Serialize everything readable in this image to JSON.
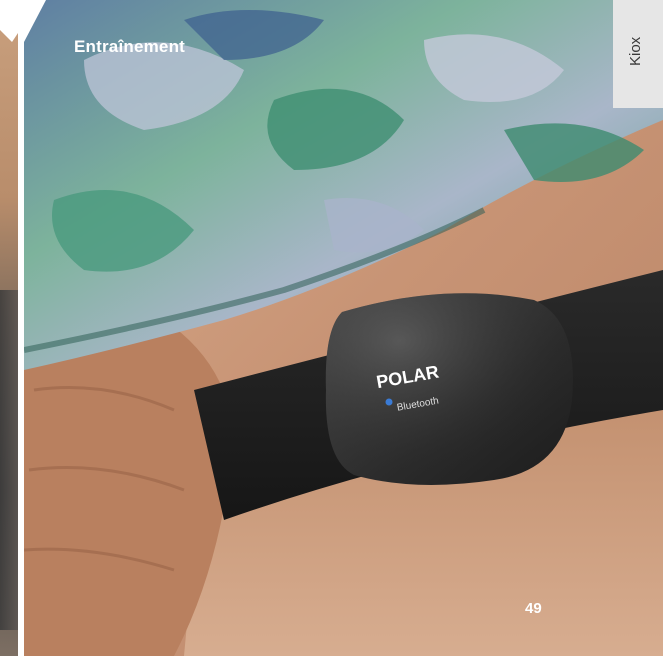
{
  "section": {
    "title": "Entraînement"
  },
  "side_tab": {
    "label": "Kiox"
  },
  "page": {
    "number": "49"
  },
  "photo": {
    "subject": "heart-rate-chest-strap",
    "logo_text": "POLAR",
    "sub_logo_text": "Bluetooth"
  },
  "colors": {
    "tab_background": "#e6e6e6",
    "title_text": "#ffffff",
    "page_number_text": "#ffffff"
  }
}
